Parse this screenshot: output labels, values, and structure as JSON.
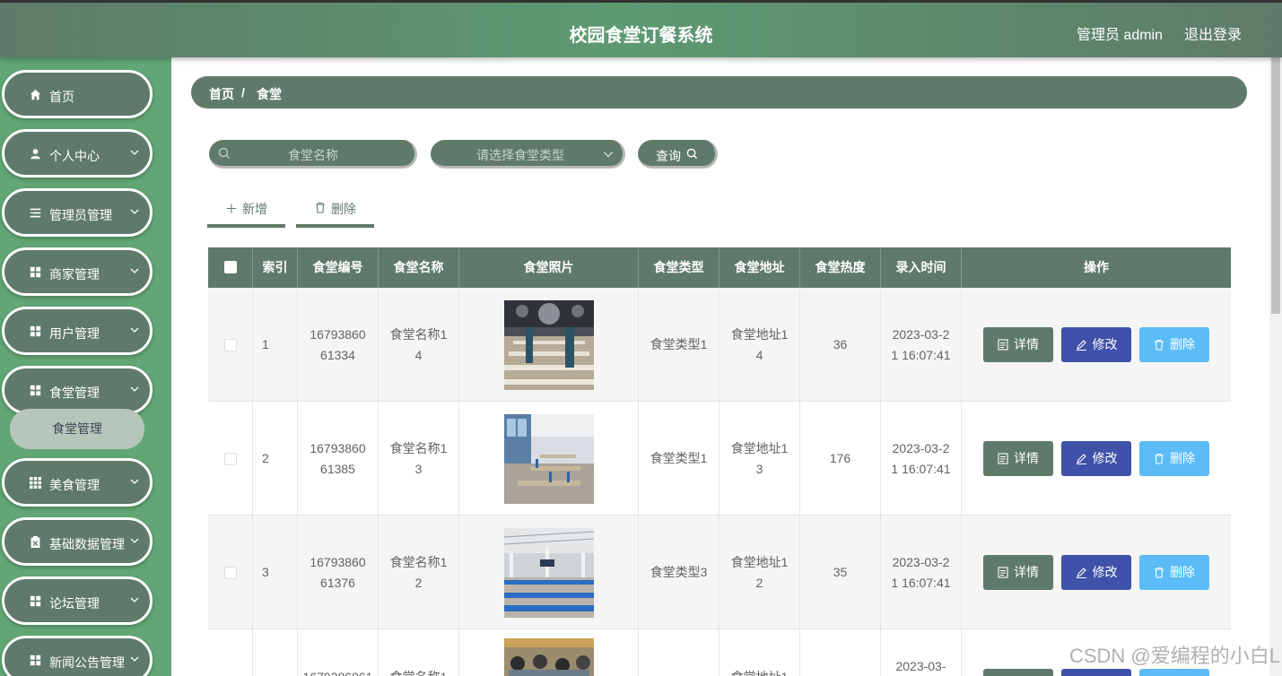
{
  "header": {
    "title": "校园食堂订餐系统",
    "admin_label": "管理员 admin",
    "logout_label": "退出登录"
  },
  "sidebar": {
    "items": [
      {
        "label": "首页",
        "icon": "home-icon",
        "has_arrow": false
      },
      {
        "label": "个人中心",
        "icon": "user-icon",
        "has_arrow": true
      },
      {
        "label": "管理员管理",
        "icon": "list-icon",
        "has_arrow": true
      },
      {
        "label": "商家管理",
        "icon": "grid-icon",
        "has_arrow": true
      },
      {
        "label": "用户管理",
        "icon": "grid-icon",
        "has_arrow": true
      },
      {
        "label": "食堂管理",
        "icon": "grid-icon",
        "has_arrow": true
      },
      {
        "label": "美食管理",
        "icon": "grid9-icon",
        "has_arrow": true
      },
      {
        "label": "基础数据管理",
        "icon": "clipboard-icon",
        "has_arrow": true
      },
      {
        "label": "论坛管理",
        "icon": "grid-icon",
        "has_arrow": true
      },
      {
        "label": "新闻公告管理",
        "icon": "grid-icon",
        "has_arrow": true
      }
    ],
    "submenu_label": "食堂管理"
  },
  "breadcrumb": {
    "home": "首页",
    "separator": "/",
    "current": "食堂"
  },
  "search": {
    "name_placeholder": "食堂名称",
    "type_placeholder": "请选择食堂类型",
    "query_label": "查询"
  },
  "actions": {
    "add_label": "新增",
    "delete_label": "删除"
  },
  "table": {
    "columns": [
      "索引",
      "食堂编号",
      "食堂名称",
      "食堂照片",
      "食堂类型",
      "食堂地址",
      "食堂热度",
      "录入时间",
      "操作"
    ],
    "rows": [
      {
        "index": "1",
        "code": "1679386061334",
        "name": "食堂名称14",
        "type": "食堂类型1",
        "address": "食堂地址14",
        "heat": "36",
        "time": "2023-03-21 16:07:41"
      },
      {
        "index": "2",
        "code": "1679386061385",
        "name": "食堂名称13",
        "type": "食堂类型1",
        "address": "食堂地址13",
        "heat": "176",
        "time": "2023-03-21 16:07:41"
      },
      {
        "index": "3",
        "code": "1679386061376",
        "name": "食堂名称12",
        "type": "食堂类型3",
        "address": "食堂地址12",
        "heat": "35",
        "time": "2023-03-21 16:07:41"
      },
      {
        "index": "",
        "code": "1679386061",
        "name": "食堂名称1",
        "type": "",
        "address": "食堂地址1",
        "heat": "",
        "time": "2023-03-"
      }
    ],
    "op_detail": "详情",
    "op_edit": "修改",
    "op_delete": "删除"
  },
  "watermark": "CSDN @爱编程的小白L"
}
